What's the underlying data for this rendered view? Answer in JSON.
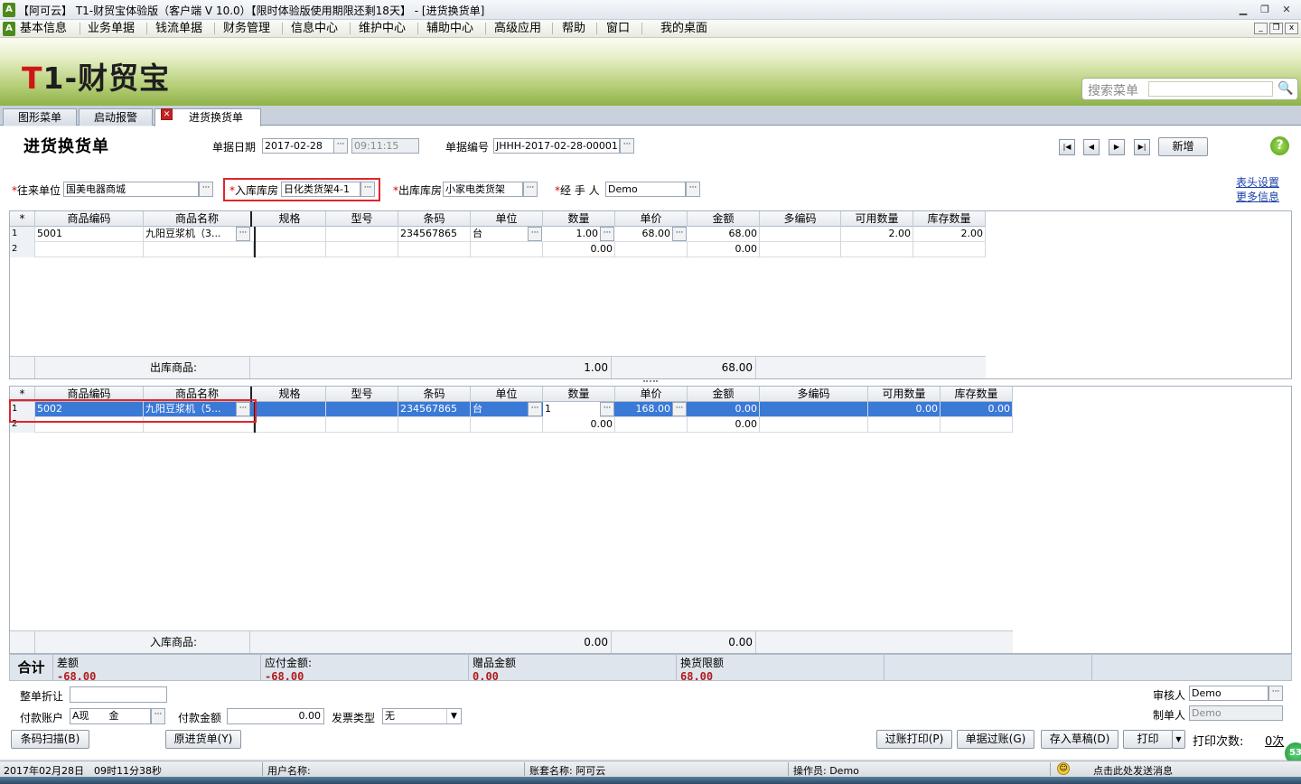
{
  "window": {
    "title": "【阿可云】 T1-财贸宝体验版（客户端 V 10.0）【限时体验版使用期限还剩18天】 - [进货换货单]"
  },
  "menu": {
    "items": [
      "基本信息",
      "业务单据",
      "钱流单据",
      "财务管理",
      "信息中心",
      "维护中心",
      "辅助中心",
      "高级应用",
      "帮助",
      "窗口",
      "我的桌面"
    ]
  },
  "banner": {
    "logo_t": "T",
    "logo_rest": "1-财贸宝",
    "search_label": "搜索菜单"
  },
  "tabs": [
    {
      "label": "图形菜单"
    },
    {
      "label": "启动报警"
    },
    {
      "label": "进货换货单"
    }
  ],
  "header": {
    "title": "进货换货单",
    "date_label": "单据日期",
    "date_value": "2017-02-28",
    "time_value": "09:11:15",
    "no_label": "单据编号",
    "no_value": "JHHH-2017-02-28-00001",
    "new_button": "新增",
    "partner_label": "往来单位",
    "partner_value": "国美电器商城",
    "in_wh_label": "入库库房",
    "in_wh_value": "日化类货架4-1",
    "out_wh_label": "出库库房",
    "out_wh_value": "小家电类货架",
    "handler_label": "经 手 人",
    "handler_value": "Demo",
    "link_header": "表头设置",
    "link_more": "更多信息"
  },
  "grid_out": {
    "columns": [
      "商品编码",
      "商品名称",
      "规格",
      "型号",
      "条码",
      "单位",
      "数量",
      "单价",
      "金额",
      "多编码",
      "可用数量",
      "库存数量"
    ],
    "rows": [
      {
        "n": "1",
        "code": "5001",
        "name": "九阳豆浆机（3...",
        "spec": "",
        "model": "",
        "barcode": "234567865",
        "unit": "台",
        "qty": "1.00",
        "price": "68.00",
        "amount": "68.00",
        "multi": "",
        "avail": "2.00",
        "stock": "2.00"
      },
      {
        "n": "2",
        "code": "",
        "name": "",
        "spec": "",
        "model": "",
        "barcode": "",
        "unit": "",
        "qty": "0.00",
        "price": "",
        "amount": "0.00",
        "multi": "",
        "avail": "",
        "stock": ""
      }
    ],
    "footer": {
      "label": "出库商品:",
      "qty": "1.00",
      "amount": "68.00"
    }
  },
  "grid_in": {
    "columns": [
      "商品编码",
      "商品名称",
      "规格",
      "型号",
      "条码",
      "单位",
      "数量",
      "单价",
      "金额",
      "多编码",
      "可用数量",
      "库存数量"
    ],
    "rows": [
      {
        "n": "1",
        "code": "5002",
        "name": "九阳豆浆机（5...",
        "spec": "",
        "model": "",
        "barcode": "234567865",
        "unit": "台",
        "qty": "1",
        "price": "168.00",
        "amount": "0.00",
        "multi": "",
        "avail": "0.00",
        "stock": "0.00"
      },
      {
        "n": "2",
        "code": "",
        "name": "",
        "spec": "",
        "model": "",
        "barcode": "",
        "unit": "",
        "qty": "0.00",
        "price": "",
        "amount": "0.00",
        "multi": "",
        "avail": "",
        "stock": ""
      }
    ],
    "footer": {
      "label": "入库商品:",
      "qty": "0.00",
      "amount": "0.00"
    }
  },
  "summary": {
    "label": "合计",
    "diff_label": "差额",
    "diff_value": "-68.00",
    "payable_label": "应付金额:",
    "payable_value": "-68.00",
    "gift_label": "赠品金额",
    "gift_value": "0.00",
    "limit_label": "换货限额",
    "limit_value": "68.00"
  },
  "bottom": {
    "discount_label": "整单折让",
    "discount_value": "",
    "account_label": "付款账户",
    "account_value": "A现　　金",
    "payamt_label": "付款金额",
    "payamt_value": "0.00",
    "invoice_label": "发票类型",
    "invoice_value": "无",
    "reviewer_label": "审核人",
    "reviewer_value": "Demo",
    "maker_label": "制单人",
    "maker_value": "Demo",
    "btn_barcode": "条码扫描(B)",
    "btn_original": "原进货单(Y)",
    "btn_post_print": "过账打印(P)",
    "btn_post": "单据过账(G)",
    "btn_draft": "存入草稿(D)",
    "btn_print": "打印",
    "print_count_label": "打印次数:",
    "print_count_value": "0次"
  },
  "status": {
    "datetime": "2017年02月28日　09时11分38秒",
    "user": "用户名称:",
    "account": "账套名称: 阿可云",
    "operator": "操作员: Demo",
    "message": "点击此处发送消息",
    "badge": "53"
  }
}
